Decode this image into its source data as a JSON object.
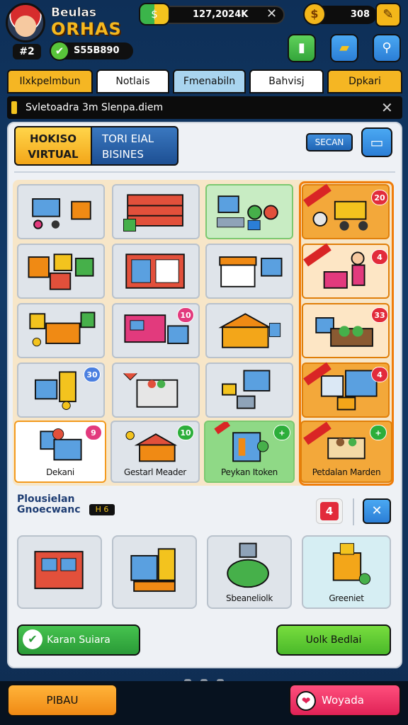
{
  "player": {
    "name": "Beulas",
    "subtitle": "ORHAS",
    "level_badge": "#2",
    "gems": "S55B890"
  },
  "hud": {
    "cash": "127,2024K",
    "coins": "308",
    "gem_glyph": "✔",
    "cash_glyph": "$",
    "coin_glyph": "$",
    "close_glyph": "✕",
    "tool_glyph": "✎",
    "btn_glyphs": [
      "▮",
      "▰",
      "⚲"
    ]
  },
  "tabs": [
    "Ilxkpelmbun",
    "Notlais",
    "Fmenabiln",
    "Bahvisj",
    "Dpkari"
  ],
  "banner": {
    "text": "Svletoadra  3m  Slenpa.diem",
    "close_glyph": "✕"
  },
  "panel": {
    "title_yellow": "HOKISO VIRTUAL",
    "title_blue": "TORI EIAL BISINES",
    "search_label": "SECAN",
    "cart_glyph": "▭"
  },
  "grid": {
    "badges": {
      "r0c3": "20",
      "r1c3": "4",
      "r2c2": "10",
      "r2c3": "33",
      "r3c1": "30",
      "r3c3": "4",
      "r4c0": "9",
      "r4c1": "10",
      "r4c2": "+",
      "r4c3": "+"
    },
    "labels": {
      "r4c0": "Dekani",
      "r4c1": "Gestarl Meader",
      "r4c2": "Peykan Itoken",
      "r4c3": "Petdalan Marden"
    }
  },
  "section": {
    "title_line1": "Plousielan",
    "title_line2": "Gnoecwanc",
    "badge": "H 6",
    "red_count": "4",
    "tools_glyph": "✕",
    "cards": [
      {
        "label": ""
      },
      {
        "label": ""
      },
      {
        "label": "Sbeaneliolk"
      },
      {
        "label": "Greeniet"
      }
    ]
  },
  "actions": {
    "left_green": "Karan Suiara",
    "check_glyph": "✔",
    "right_green": "Uolk Bedlai",
    "bottom_left": "PIBAU",
    "bottom_right": "Woyada",
    "heart_glyph": "❤"
  },
  "colors": {
    "accent_orange": "#f08a14",
    "accent_blue": "#2b7ed6",
    "accent_green": "#2a9a37",
    "accent_pink": "#e02256"
  }
}
